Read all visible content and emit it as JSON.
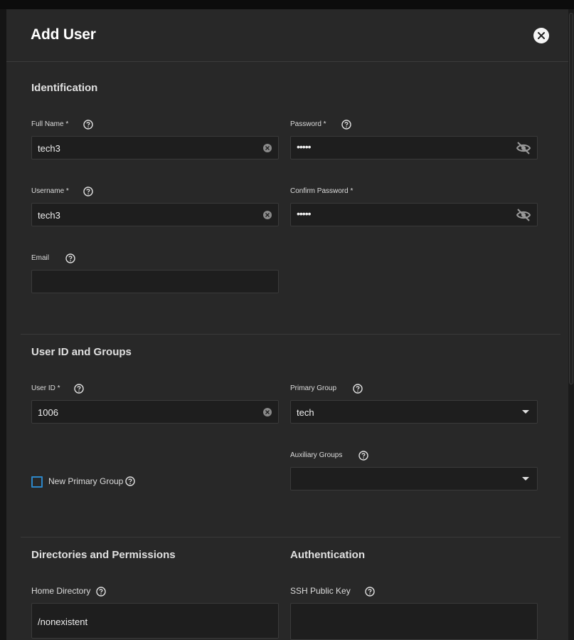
{
  "dialog": {
    "title": "Add User"
  },
  "identification": {
    "title": "Identification",
    "full_name": {
      "label": "Full Name *",
      "value": "tech3"
    },
    "password": {
      "label": "Password *",
      "value": "•••••"
    },
    "username": {
      "label": "Username *",
      "value": "tech3"
    },
    "confirm_password": {
      "label": "Confirm Password *",
      "value": "•••••"
    },
    "email": {
      "label": "Email",
      "value": ""
    }
  },
  "user_id_groups": {
    "title": "User ID and Groups",
    "user_id": {
      "label": "User ID *",
      "value": "1006"
    },
    "primary_group": {
      "label": "Primary Group",
      "value": "tech"
    },
    "auxiliary_groups": {
      "label": "Auxiliary Groups",
      "value": ""
    },
    "new_primary_group": {
      "label": "New Primary Group",
      "checked": false
    }
  },
  "directories": {
    "title": "Directories and Permissions",
    "home_directory": {
      "label": "Home Directory",
      "value": "/nonexistent"
    }
  },
  "authentication": {
    "title": "Authentication",
    "ssh_key": {
      "label": "SSH Public Key",
      "value": ""
    }
  },
  "colors": {
    "accent": "#2d87c8",
    "panel": "#282828",
    "field": "#1e1e1e"
  }
}
